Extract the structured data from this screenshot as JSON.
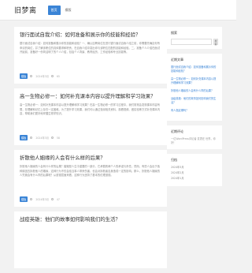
{
  "header": {
    "logo": "旧梦离",
    "nav": [
      "首页",
      "模版"
    ]
  },
  "posts": [
    {
      "title": "银行面试自我介绍：如何准备和展示你的技能和经验？",
      "excerpt": "银行面试自我介绍：如何准备和展示你的技能和经验？一、确认应聘岗位在进行银行面试自我介绍之前，你需要先确定你所申请的岗位，并了解该职位的具体要求和职责，在自我介绍中突出你与该职位匹配的技能和经验。二、准备个人介绍在面试开始前，准备好一份简洁明了的个人介绍，包括个人背景、教育经历、工作经验和专业技能等。",
      "tag": "模板",
      "date": "2024年3月",
      "views": "65"
    },
    {
      "title": "高一生物必修一：如何补充课本内容以提升理解和学习效果？",
      "excerpt": "高一生物必修一：如何补充课本内容以提升理解和学习效果？在高一生物必修一的学习过程中，我们常常会发现课本内容有限，在理解和记忆上存在一定困难。为了提升学习效果，我们可以通过查阅相关资料、观看视频、做实验等方式补充课本内容，帮助我们更好地掌握生物学知识。",
      "tag": "模板",
      "date": "2024年3月",
      "views": "58"
    },
    {
      "title": "折散他人姻缘的人会有什么样的后果？",
      "excerpt": "折散他人姻缘的人会有什么样的后果？婚姻是人生中重要的一部分，它承载着两个人的承诺与责任。然而，有些人会出于各种原因去拆散他人的姻缘，这种行为不仅会给当事人带来伤害，也会对拆散者自身造成一定的影响。那么，折散他人姻缘的人究竟会有什么样的后果呢？从道德层面来看，这种行为违背了基本的伦理道德。",
      "tag": "模板",
      "date": "2024年3月",
      "views": "47"
    },
    {
      "title": "战疫英雄：他们的故事如何影响我们的生活？",
      "excerpt": "",
      "tag": "",
      "date": "",
      "views": ""
    }
  ],
  "sidebar": {
    "search": {
      "title": "搜索",
      "placeholder": "",
      "button": "搜索"
    },
    "recent": {
      "title": "近期文章",
      "items": [
        "银行面试自我介绍：如何准备和展示你的技能和经验？",
        "高一生物必修一：如何补充课本内容以提升理解和学习效果？",
        "折散他人姻缘的人会有什么样的后果？",
        "战疫英雄：他们的故事如何影响我们的生活？",
        "有人指定哪吗？"
      ]
    },
    "comments": {
      "title": "近期评论",
      "text": "一位WordPress评论者 发表在 世界，你好！"
    },
    "archives": {
      "title": "归档",
      "items": [
        "2024年3月",
        "2024年2月",
        "2024年1月"
      ]
    }
  }
}
